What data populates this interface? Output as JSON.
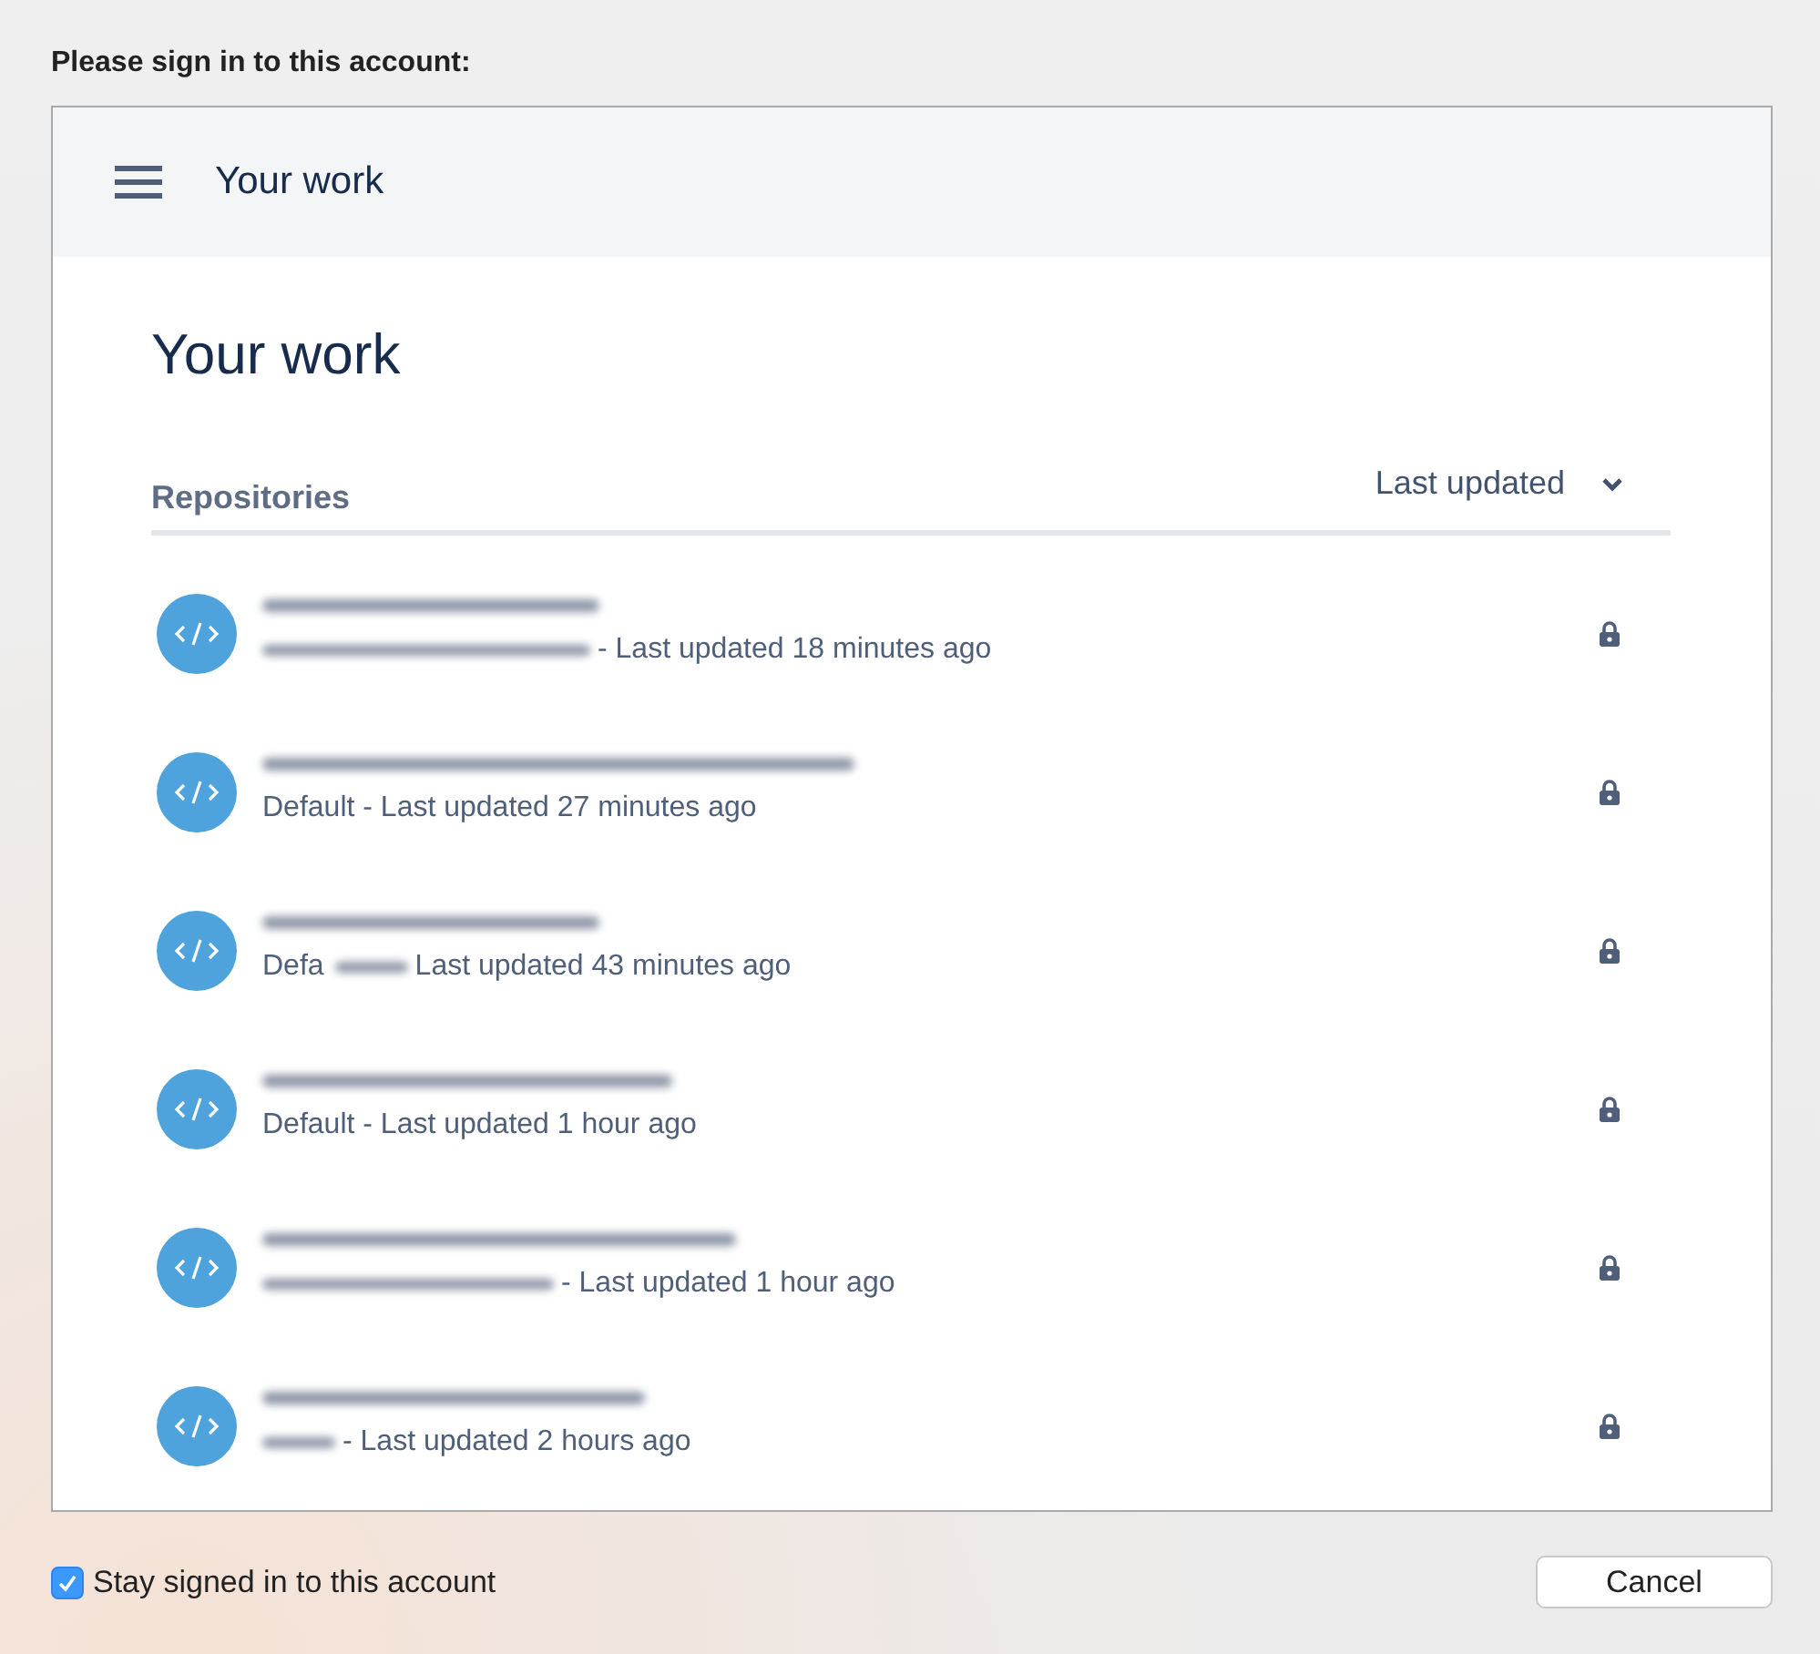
{
  "prompt": "Please sign in to this account:",
  "header": {
    "title": "Your work"
  },
  "page_title": "Your work",
  "section": {
    "title": "Repositories",
    "sort": "Last updated"
  },
  "repositories": [
    {
      "blurred_prefix": true,
      "updated": "- Last updated 18 minutes ago",
      "locked": true
    },
    {
      "blurred_prefix": false,
      "updated": "Default - Last updated 27 minutes ago",
      "locked": true
    },
    {
      "lead": "Defa",
      "blurred_prefix": true,
      "updated": "Last updated 43 minutes ago",
      "locked": true
    },
    {
      "blurred_prefix": false,
      "updated": "Default - Last updated 1 hour ago",
      "locked": true
    },
    {
      "blurred_prefix": true,
      "updated": "- Last updated 1 hour ago",
      "locked": true
    },
    {
      "blurred_prefix": true,
      "updated": "- Last updated 2 hours ago",
      "locked": true
    }
  ],
  "stay_signed_in": {
    "label": "Stay signed in to this account",
    "checked": true
  },
  "buttons": [
    "Cancel"
  ]
}
